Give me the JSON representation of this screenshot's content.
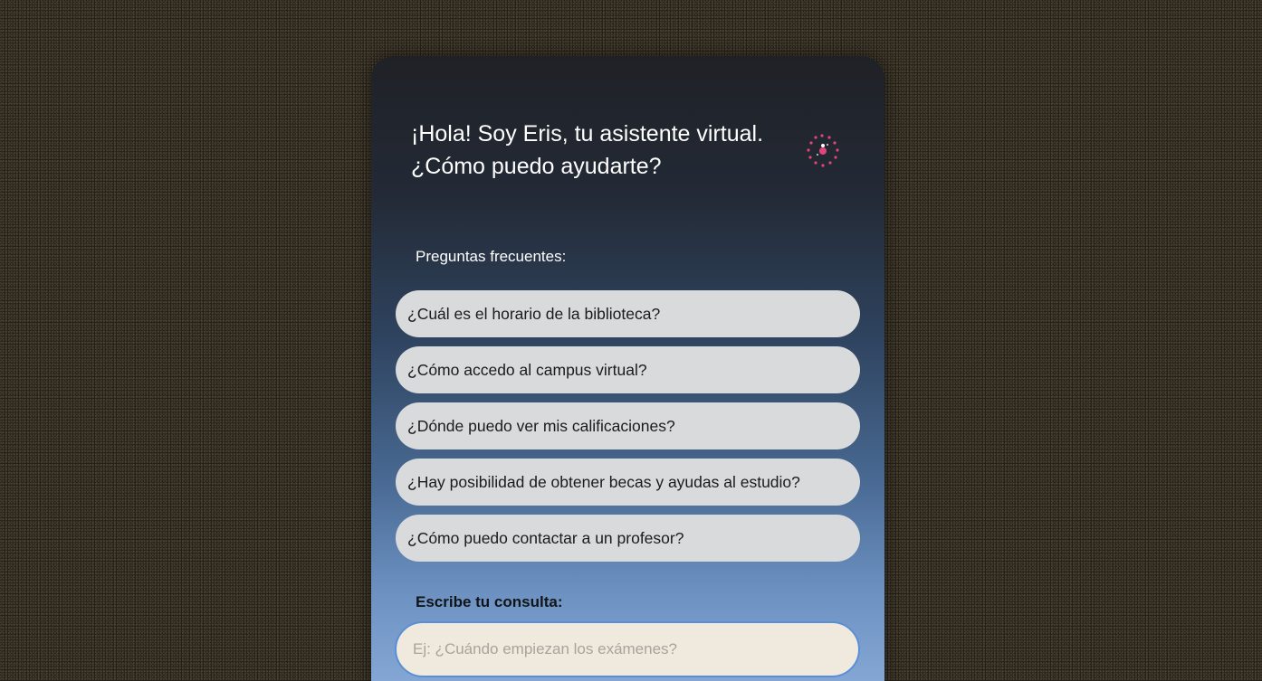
{
  "assistant": {
    "greeting_line1": "¡Hola! Soy Eris, tu asistente virtual.",
    "greeting_line2": "¿Cómo puedo ayudarte?",
    "icon": "sparkle-bot-icon"
  },
  "faq": {
    "label": "Preguntas frecuentes:",
    "items": [
      {
        "label": "¿Cuál es el horario de la biblioteca?"
      },
      {
        "label": "¿Cómo accedo al campus virtual?"
      },
      {
        "label": "¿Dónde puedo ver mis calificaciones?"
      },
      {
        "label": "¿Hay posibilidad de obtener becas y ayudas al estudio?"
      },
      {
        "label": "¿Cómo puedo contactar a un profesor?"
      }
    ]
  },
  "query": {
    "label": "Escribe tu consulta:",
    "placeholder": "Ej: ¿Cuándo empiezan los exámenes?",
    "value": ""
  },
  "colors": {
    "accent_icon": "#e0457b",
    "faq_button_bg": "#d9dadc",
    "input_border": "#5a8fd6"
  }
}
